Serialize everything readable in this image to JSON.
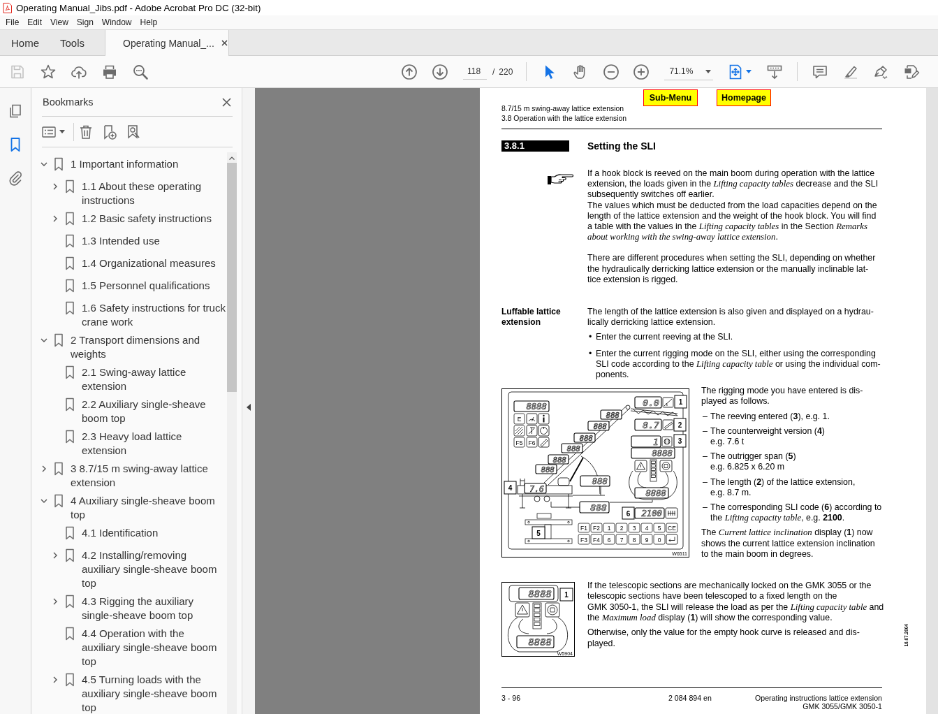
{
  "window": {
    "title": "Operating Manual_Jibs.pdf - Adobe Acrobat Pro DC (32-bit)"
  },
  "menu_bar": [
    "File",
    "Edit",
    "View",
    "Sign",
    "Window",
    "Help"
  ],
  "tabs": [
    {
      "label": "Home",
      "kind": "nav",
      "selected": false
    },
    {
      "label": "Tools",
      "kind": "nav",
      "selected": false
    },
    {
      "label": "Operating Manual_...",
      "kind": "document",
      "selected": true
    }
  ],
  "toolbar": {
    "quick_tools": [
      {
        "kind": "save",
        "disabled": true
      },
      {
        "kind": "star",
        "disabled": false
      },
      {
        "kind": "upload",
        "disabled": false
      },
      {
        "kind": "print",
        "disabled": false
      },
      {
        "kind": "find",
        "disabled": false
      }
    ],
    "page_number": "118",
    "page_separator": "/",
    "page_count": "220",
    "pointer_tools": [
      {
        "kind": "select",
        "selected": true
      },
      {
        "kind": "hand",
        "selected": false
      }
    ],
    "zoom_level": "71.1%"
  },
  "side_rail": [
    {
      "kind": "pages",
      "selected": false
    },
    {
      "kind": "bookmarks",
      "selected": true
    },
    {
      "kind": "attachments",
      "selected": false
    }
  ],
  "bookmarks_panel": {
    "title": "Bookmarks",
    "items": [
      {
        "label": "1 Important information",
        "kind": "branch",
        "expanded": true,
        "selected": false,
        "children": [
          {
            "label": "1.1 About these operating\ninstructions",
            "kind": "branch",
            "expanded": false,
            "selected": false
          },
          {
            "label": "1.2 Basic safety instructions",
            "kind": "branch",
            "expanded": false,
            "selected": false
          },
          {
            "label": "1.3 Intended use",
            "kind": "leaf",
            "selected": false
          },
          {
            "label": "1.4 Organizational measures",
            "kind": "leaf",
            "selected": false
          },
          {
            "label": "1.5 Personnel qualifications",
            "kind": "leaf",
            "selected": false
          },
          {
            "label": "1.6 Safety instructions for truck\ncrane work",
            "kind": "leaf",
            "selected": false
          }
        ]
      },
      {
        "label": "2 Transport dimensions and\nweights",
        "kind": "branch",
        "expanded": true,
        "selected": false,
        "children": [
          {
            "label": "2.1 Swing-away lattice\nextension",
            "kind": "leaf",
            "selected": false
          },
          {
            "label": "2.2 Auxiliary single-sheave\nboom top",
            "kind": "leaf",
            "selected": false
          },
          {
            "label": "2.3 Heavy load lattice\nextension",
            "kind": "leaf",
            "selected": false
          }
        ]
      },
      {
        "label": "3 8.7/15 m swing-away lattice\nextension",
        "kind": "branch",
        "expanded": false,
        "selected": false
      },
      {
        "label": "4 Auxiliary single-sheave boom\ntop",
        "kind": "branch",
        "expanded": true,
        "selected": false,
        "children": [
          {
            "label": "4.1 Identification",
            "kind": "leaf",
            "selected": false
          },
          {
            "label": "4.2 Installing/removing\nauxiliary single-sheave boom\ntop",
            "kind": "branch",
            "expanded": false,
            "selected": false
          },
          {
            "label": "4.3 Rigging the auxiliary\nsingle-sheave boom top",
            "kind": "branch",
            "expanded": false,
            "selected": false
          },
          {
            "label": "4.4 Operation with the\nauxiliary single-sheave boom\ntop",
            "kind": "leaf",
            "selected": false
          },
          {
            "label": "4.5 Turning loads with the\nauxiliary single-sheave boom\ntop",
            "kind": "branch",
            "expanded": false,
            "selected": false
          }
        ]
      }
    ]
  },
  "document": {
    "nav_buttons": [
      "Sub-Menu",
      "Homepage"
    ],
    "running_head": [
      "8.7/15 m swing-away lattice extension",
      "3.8 Operation with the lattice extension"
    ],
    "section_number": "3.8.1",
    "section_title": "Setting the SLI",
    "note": [
      "If a hook block is reeved on the main boom during operation with the lattice\nextension, the loads given in the *Lifting capacity tables* decrease and the SLI\nsubsequently switches off earlier.",
      "The values which must be deducted from the load capacities depend on the\nlength of the lattice extension and the weight of the hook block. You will find\na table with the values in the *Lifting capacity tables* in the Section *Remarks*\n*about working with the swing-away lattice extension*."
    ],
    "intro": "There are different procedures when setting the SLI, depending on whether\nthe hydraulically derricking lattice extension or the manually inclinable lat-\ntice extension is rigged.",
    "luffable": {
      "label": "Luffable lattice\nextension",
      "text": "The length of the lattice extension is also given and displayed on a hydrau-\nlically derricking lattice extension.",
      "steps": [
        {
          "marker": "•",
          "text": "Enter the current reeving at the SLI."
        },
        {
          "marker": "•",
          "text": "Enter the current rigging mode on the SLI, either using the corresponding\nSLI code according to the *Lifting capacity table* or using the individual com-\nponents."
        }
      ]
    },
    "figure_1": {
      "displays": [
        "8888",
        "888",
        "888",
        "888",
        "888",
        "888",
        "888",
        "888",
        "888",
        "0.0",
        "8.7",
        "1",
        "8888",
        "8888",
        "2100",
        "7.6"
      ],
      "callouts": [
        "1",
        "2",
        "3",
        "4",
        "5",
        "6"
      ],
      "function_keys": [
        "E",
        "F5",
        "F6"
      ],
      "keypad": [
        "F1",
        "F2",
        "1",
        "2",
        "3",
        "4",
        "5",
        "CE",
        "F3",
        "F4",
        "6",
        "7",
        "8",
        "9",
        "0"
      ],
      "image_code": "W6511"
    },
    "rigging": {
      "intro": "The rigging mode you have entered is dis-\nplayed as follows.",
      "items": [
        {
          "marker": "–",
          "text": "The reeving entered (**3**), e.g. 1."
        },
        {
          "marker": "–",
          "text": "The counterweight version (**4**)\ne.g. 7.6 t"
        },
        {
          "marker": "–",
          "text": "The outrigger span (**5**)\ne.g. 6.825 x 6.20 m"
        },
        {
          "marker": "–",
          "text": "The length (**2**) of the lattice extension,\ne.g. 8.7 m."
        },
        {
          "marker": "–",
          "text": "The corresponding SLI code (**6**) according to\nthe *Lifting capacity table*, e.g. **2100**."
        }
      ],
      "outro": "The *Current lattice inclination* display (**1**) now\nshows the current lattice extension inclination\nto the main boom in degrees."
    },
    "figure_2": {
      "displays": [
        "8888",
        "8888"
      ],
      "callouts": [
        "1"
      ],
      "image_code": "W5904"
    },
    "locked": [
      "If the telescopic sections are mechanically locked on the GMK 3055 or the\ntelescopic sections have been telescoped to a fixed length on the\nGMK 3050-1, the SLI will release the load as per the *Lifting capacity table* and\nthe *Maximum load* display (**1**) will show the corresponding value.",
      "Otherwise, only the value for the empty hook curve is released and dis-\nplayed."
    ],
    "footer": {
      "page": "3 - 96",
      "code": "2 084 894 en",
      "title": "Operating instructions lattice extension\nGMK 3055/GMK 3050-1"
    },
    "date": "16.07.2004"
  }
}
